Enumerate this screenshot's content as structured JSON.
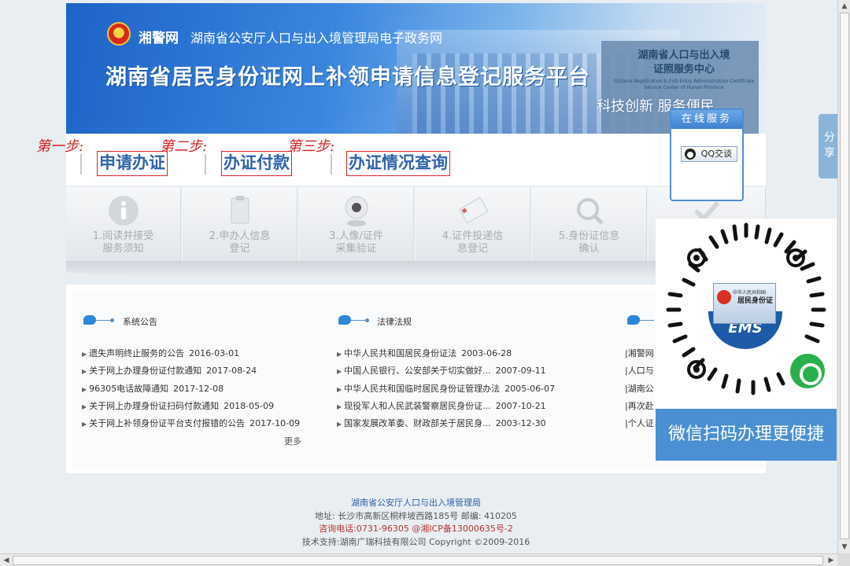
{
  "banner": {
    "brand": "湘警网",
    "dept": "湖南省公安厅人口与出入境管理局电子政务网",
    "title": "湖南省居民身份证网上补领申请信息登记服务平台",
    "plaque_line1": "湖南省人口与出入境",
    "plaque_line2": "证照服务中心",
    "plaque_en": "Citizens Registration & Exit-Entry Administration Certificate Service Center of Hunan Province",
    "slogan": "科技创新 服务便民"
  },
  "nav": {
    "step1": "第一步:",
    "step2": "第二步:",
    "step3": "第三步:",
    "links": [
      "申请办证",
      "办证付款",
      "办证情况查询"
    ]
  },
  "process": [
    {
      "line1": "1.阅读并接受",
      "line2": "服务须知",
      "icon": "info-icon"
    },
    {
      "line1": "2.申办人信息",
      "line2": "登记",
      "icon": "clipboard-icon"
    },
    {
      "line1": "3.人像/证件",
      "line2": "采集验证",
      "icon": "webcam-icon"
    },
    {
      "line1": "4.证件投递信",
      "line2": "息登记",
      "icon": "envelope-icon"
    },
    {
      "line1": "5.身份证信息",
      "line2": "确认",
      "icon": "search-doc-icon"
    }
  ],
  "sections": {
    "notice": {
      "title": "系统公告",
      "items": [
        {
          "text": "遗失声明终止服务的公告",
          "date": "2016-03-01"
        },
        {
          "text": "关于网上办理身份证付款通知",
          "date": "2017-08-24"
        },
        {
          "text": "96305电话故障通知",
          "date": "2017-12-08"
        },
        {
          "text": "关于网上办理身份证扫码付款通知",
          "date": "2018-05-09"
        },
        {
          "text": "关于网上补领身份证平台支付报错的公告",
          "date": "2017-10-09"
        }
      ],
      "more": "更多"
    },
    "law": {
      "title": "法律法规",
      "items": [
        {
          "text": "中华人民共和国居民身份证法",
          "date": "2003-06-28"
        },
        {
          "text": "中国人民银行、公安部关于切实做好...",
          "date": "2007-09-11"
        },
        {
          "text": "中华人民共和国临时居民身份证管理办法",
          "date": "2005-06-07"
        },
        {
          "text": "现役军人和人民武装警察居民身份证...",
          "date": "2007-10-21"
        },
        {
          "text": "国家发展改革委、财政部关于居民身...",
          "date": "2003-12-30"
        }
      ]
    },
    "links": {
      "items": [
        "|湘警网",
        "|人口与",
        "|湖南公",
        "|再次赴",
        "|个人证"
      ]
    }
  },
  "service": {
    "title": "在线服务",
    "qq": "QQ交谈"
  },
  "share": "分享",
  "qr": {
    "card_line1": "中华人民共和国",
    "card_line2": "居民身份证",
    "ems": "EMS",
    "caption": "微信扫码办理更便捷"
  },
  "footer": {
    "org": "湖南省公安厅人口与出入境管理局",
    "address": "地址: 长沙市高新区桐梓坡西路185号 邮编: 410205",
    "phone": "咨询电话:0731-96305 @湘ICP备13000635号-2",
    "support": "技术支持:湖南广瑞科技有限公司 Copyright ©2009-2016"
  }
}
